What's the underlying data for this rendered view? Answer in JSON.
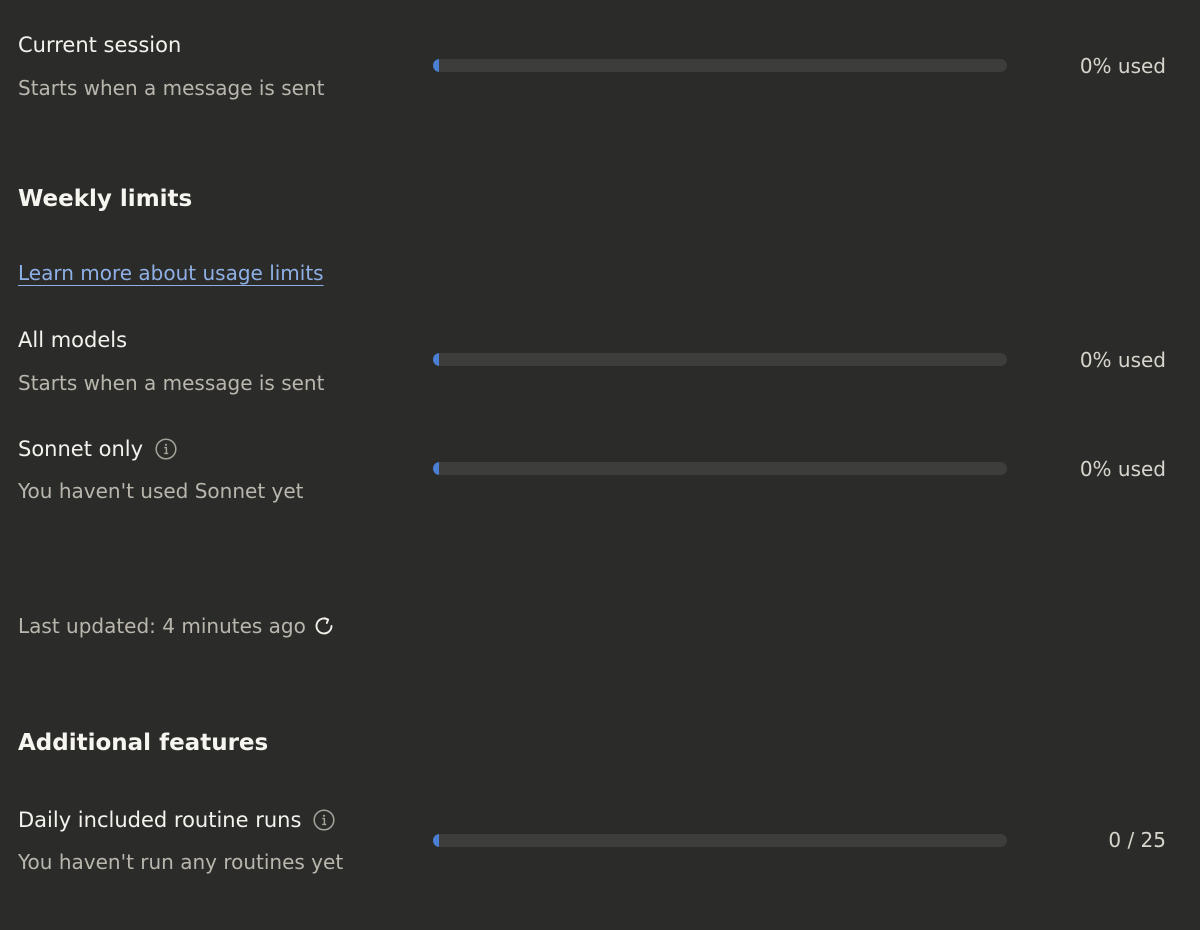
{
  "current_session": {
    "title": "Current session",
    "subtitle": "Starts when a message is sent",
    "progress": 0,
    "usage_label": "0% used"
  },
  "weekly_limits": {
    "heading": "Weekly limits",
    "learn_more_link": "Learn more about usage limits",
    "all_models": {
      "title": "All models",
      "subtitle": "Starts when a message is sent",
      "progress": 0,
      "usage_label": "0% used"
    },
    "sonnet_only": {
      "title": "Sonnet only",
      "icon": "info-icon",
      "subtitle": "You haven't used Sonnet yet",
      "progress": 0,
      "usage_label": "0% used"
    }
  },
  "last_updated": {
    "text": "Last updated: 4 minutes ago",
    "icon": "refresh-icon"
  },
  "additional_features": {
    "heading": "Additional features",
    "routine_runs": {
      "title": "Daily included routine runs",
      "icon": "info-icon",
      "subtitle": "You haven't run any routines yet",
      "used": 0,
      "limit": 25,
      "usage_label": "0 / 25"
    }
  },
  "colors": {
    "background": "#2b2b29",
    "bar_track": "#3d3d3b",
    "bar_fill": "#4a7fd4",
    "link": "#8fb0e6"
  }
}
